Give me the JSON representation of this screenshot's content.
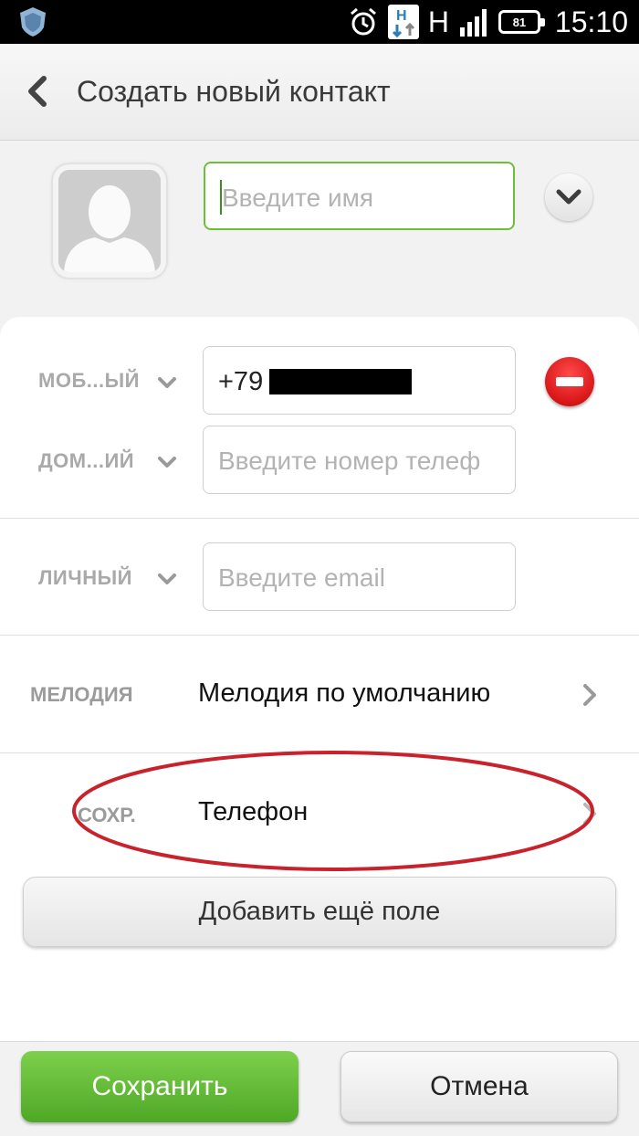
{
  "status_bar": {
    "network_type": "H",
    "battery_level": "81",
    "time": "15:10",
    "icons": [
      "shield-icon",
      "alarm-icon",
      "data-transfer-icon",
      "signal-icon",
      "battery-icon"
    ]
  },
  "header": {
    "title": "Создать новый контакт",
    "back_icon": "back-arrow-icon"
  },
  "contact": {
    "name_placeholder": "Введите имя",
    "avatar_icon": "default-avatar-icon"
  },
  "phones": [
    {
      "type_label": "МОБ...ЫЙ",
      "value": "+79"
    },
    {
      "type_label": "ДОМ...ИЙ",
      "placeholder": "Введите номер телеф"
    }
  ],
  "email": {
    "type_label": "ЛИЧНЫЙ",
    "placeholder": "Введите email"
  },
  "ringtone": {
    "label": "МЕЛОДИЯ",
    "value": "Мелодия по умолчанию"
  },
  "storage": {
    "label": "СОХР.",
    "value": "Телефон"
  },
  "buttons": {
    "add_field": "Добавить ещё поле",
    "save": "Сохранить",
    "cancel": "Отмена"
  },
  "colors": {
    "accent_green": "#5cb531",
    "remove_red": "#d40000",
    "annotation_red": "#c8232c"
  }
}
